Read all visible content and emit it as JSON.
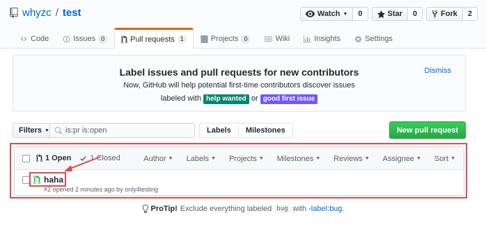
{
  "repo": {
    "owner": "whyzc",
    "separator": "/",
    "name": "test"
  },
  "actions": {
    "watch": {
      "label": "Watch",
      "count": "0"
    },
    "star": {
      "label": "Star",
      "count": "0"
    },
    "fork": {
      "label": "Fork",
      "count": "2"
    }
  },
  "tabs": [
    {
      "label": "Code",
      "icon": "code-icon"
    },
    {
      "label": "Issues",
      "icon": "issue-icon",
      "count": "0"
    },
    {
      "label": "Pull requests",
      "icon": "pull-request-icon",
      "count": "1",
      "selected": true
    },
    {
      "label": "Projects",
      "icon": "project-icon",
      "count": "0"
    },
    {
      "label": "Wiki",
      "icon": "book-icon"
    },
    {
      "label": "Insights",
      "icon": "graph-icon"
    },
    {
      "label": "Settings",
      "icon": "gear-icon"
    }
  ],
  "banner": {
    "title": "Label issues and pull requests for new contributors",
    "line1": "Now, GitHub will help potential first-time contributors discover issues",
    "line2_prefix": "labeled with",
    "label_help_wanted": "help wanted",
    "line2_or": "or",
    "label_good_first_issue": "good first issue",
    "dismiss": "Dismiss"
  },
  "subnav": {
    "filters_label": "Filters",
    "search_value": "is:pr is:open",
    "labels_link": "Labels",
    "milestones_link": "Milestones",
    "new_pr_label": "New pull request"
  },
  "list": {
    "open_label": "1 Open",
    "closed_label": "1 Closed",
    "filters": [
      "Author",
      "Labels",
      "Projects",
      "Milestones",
      "Reviews",
      "Assignee",
      "Sort"
    ],
    "items": [
      {
        "title": "haha",
        "meta": "#2 opened 2 minutes ago by only4testing"
      }
    ]
  },
  "protip": {
    "strong": "ProTip!",
    "text1": "Exclude everything labeled",
    "code": "bug",
    "text2": "with",
    "link": "-label:bug."
  },
  "colors": {
    "link": "#0366d6",
    "selected_tab_accent": "#e36209",
    "new_pr_button": "#28a745",
    "label_help_wanted": "#008672",
    "label_good_first_issue": "#7057ff",
    "open_pr_icon": "#28a745",
    "annotation_red": "#d94c4c"
  }
}
